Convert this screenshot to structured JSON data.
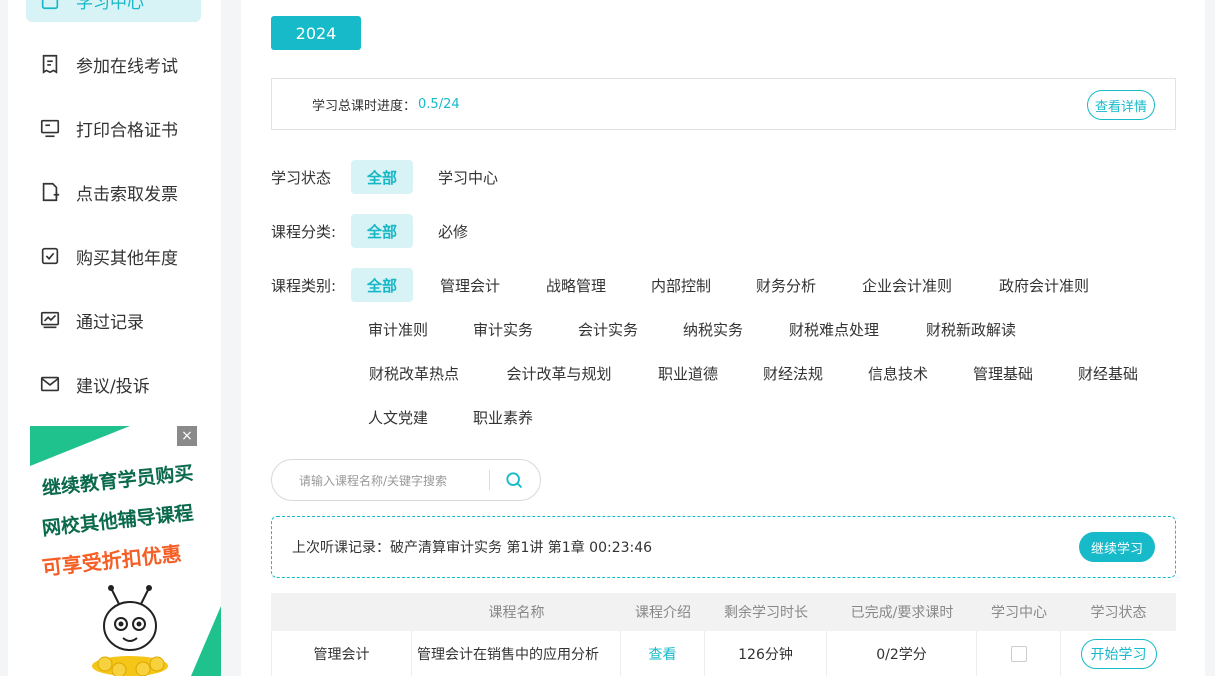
{
  "sidebar": {
    "items": [
      {
        "label": "学习中心",
        "icon": "doc-icon",
        "active": true
      },
      {
        "label": "参加在线考试",
        "icon": "exam-icon"
      },
      {
        "label": "打印合格证书",
        "icon": "certificate-icon"
      },
      {
        "label": "点击索取发票",
        "icon": "invoice-icon"
      },
      {
        "label": "购买其他年度",
        "icon": "checkbox-icon"
      },
      {
        "label": "通过记录",
        "icon": "chart-icon"
      },
      {
        "label": "建议/投诉",
        "icon": "mail-icon"
      }
    ]
  },
  "promo": {
    "line1": "继续教育学员购买",
    "line2": "网校其他辅导课程",
    "line3": "可享受折扣优惠",
    "close": "×"
  },
  "year": {
    "label": "2024"
  },
  "progress": {
    "label": "学习总课时进度：",
    "value": "0.5/24",
    "detail_label": "查看详情"
  },
  "filters": {
    "status": {
      "label": "学习状态",
      "options": [
        "全部",
        "学习中心"
      ]
    },
    "category": {
      "label": "课程分类:",
      "options": [
        "全部",
        "必修"
      ]
    },
    "type": {
      "label": "课程类别:",
      "all": "全部",
      "row1": [
        "管理会计",
        "战略管理",
        "内部控制",
        "财务分析",
        "企业会计准则",
        "政府会计准则"
      ],
      "row2": [
        "审计准则",
        "审计实务",
        "会计实务",
        "纳税实务",
        "财税难点处理",
        "财税新政解读"
      ],
      "row3": [
        "财税改革热点",
        "会计改革与规划",
        "职业道德",
        "财经法规",
        "信息技术",
        "管理基础",
        "财经基础"
      ],
      "row4": [
        "人文党建",
        "职业素养"
      ]
    }
  },
  "search": {
    "placeholder": "请输入课程名称/关键字搜索"
  },
  "last_record": {
    "text": "上次听课记录：破产清算审计实务 第1讲 第1章 00:23:46",
    "button": "继续学习"
  },
  "table": {
    "headers": [
      "",
      "课程名称",
      "课程介绍",
      "剩余学习时长",
      "已完成/要求课时",
      "学习中心",
      "学习状态"
    ],
    "rows": [
      {
        "category": "管理会计",
        "name": "管理会计在销售中的应用分析",
        "intro": "查看",
        "remaining": "126分钟",
        "done": "0/2学分",
        "action": "开始学习"
      }
    ]
  },
  "colors": {
    "accent": "#17bac9",
    "accent_light": "#d8f3f6",
    "promo_green": "#1fc28c",
    "promo_orange": "#f55e25"
  }
}
